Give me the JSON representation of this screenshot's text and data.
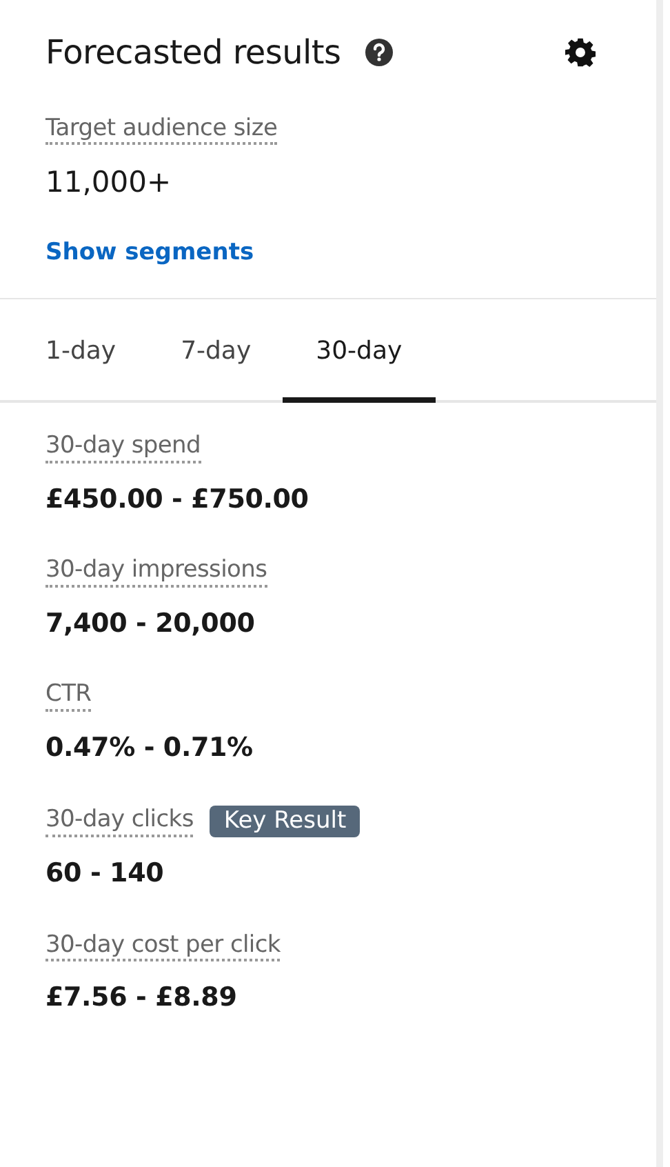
{
  "header": {
    "title": "Forecasted results"
  },
  "audience": {
    "label": "Target audience size",
    "value": "11,000+",
    "link": "Show segments"
  },
  "tabs": [
    {
      "label": "1-day",
      "selected": false
    },
    {
      "label": "7-day",
      "selected": false
    },
    {
      "label": "30-day",
      "selected": true
    }
  ],
  "metrics": [
    {
      "label": "30-day spend",
      "value": "£450.00 - £750.00"
    },
    {
      "label": "30-day impressions",
      "value": "7,400 - 20,000"
    },
    {
      "label": "CTR",
      "value": "0.47% - 0.71%"
    },
    {
      "label": "30-day clicks",
      "badge": "Key Result",
      "value": "60 - 140"
    },
    {
      "label": "30-day cost per click",
      "value": "£7.56 - £8.89"
    }
  ]
}
